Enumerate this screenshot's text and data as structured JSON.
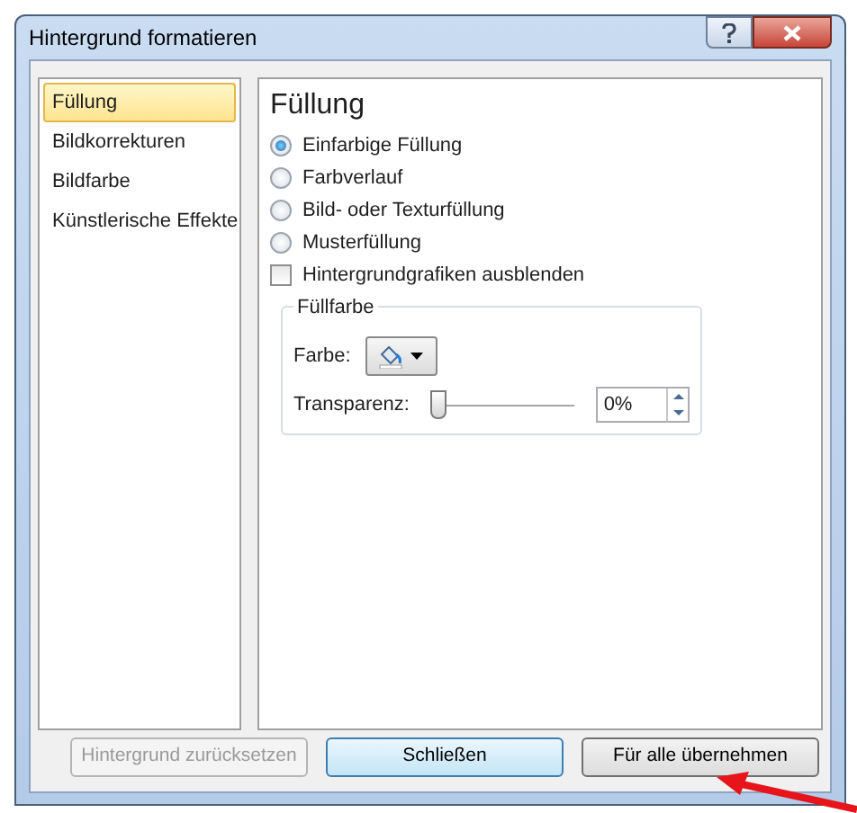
{
  "window": {
    "title": "Hintergrund formatieren"
  },
  "sidebar": {
    "items": [
      {
        "label": "Füllung",
        "selected": true
      },
      {
        "label": "Bildkorrekturen",
        "selected": false
      },
      {
        "label": "Bildfarbe",
        "selected": false
      },
      {
        "label": "Künstlerische Effekte",
        "selected": false
      }
    ]
  },
  "panel": {
    "heading": "Füllung",
    "fill_options": [
      {
        "label": "Einfarbige Füllung",
        "selected": true
      },
      {
        "label": "Farbverlauf",
        "selected": false
      },
      {
        "label": "Bild- oder Texturfüllung",
        "selected": false
      },
      {
        "label": "Musterfüllung",
        "selected": false
      }
    ],
    "hide_graphics": {
      "label": "Hintergrundgrafiken ausblenden",
      "checked": false
    },
    "fill_color": {
      "title": "Füllfarbe",
      "color_label": "Farbe:",
      "transparency_label": "Transparenz:",
      "level": 0,
      "transparency_value": "0%"
    }
  },
  "buttons": [
    {
      "label": "Hintergrund zurücksetzen",
      "disabled": true,
      "selected": false
    },
    {
      "label": "Schließen",
      "disabled": false,
      "selected": true
    },
    {
      "label": "Für alle übernehmen",
      "disabled": false,
      "selected": false
    }
  ]
}
